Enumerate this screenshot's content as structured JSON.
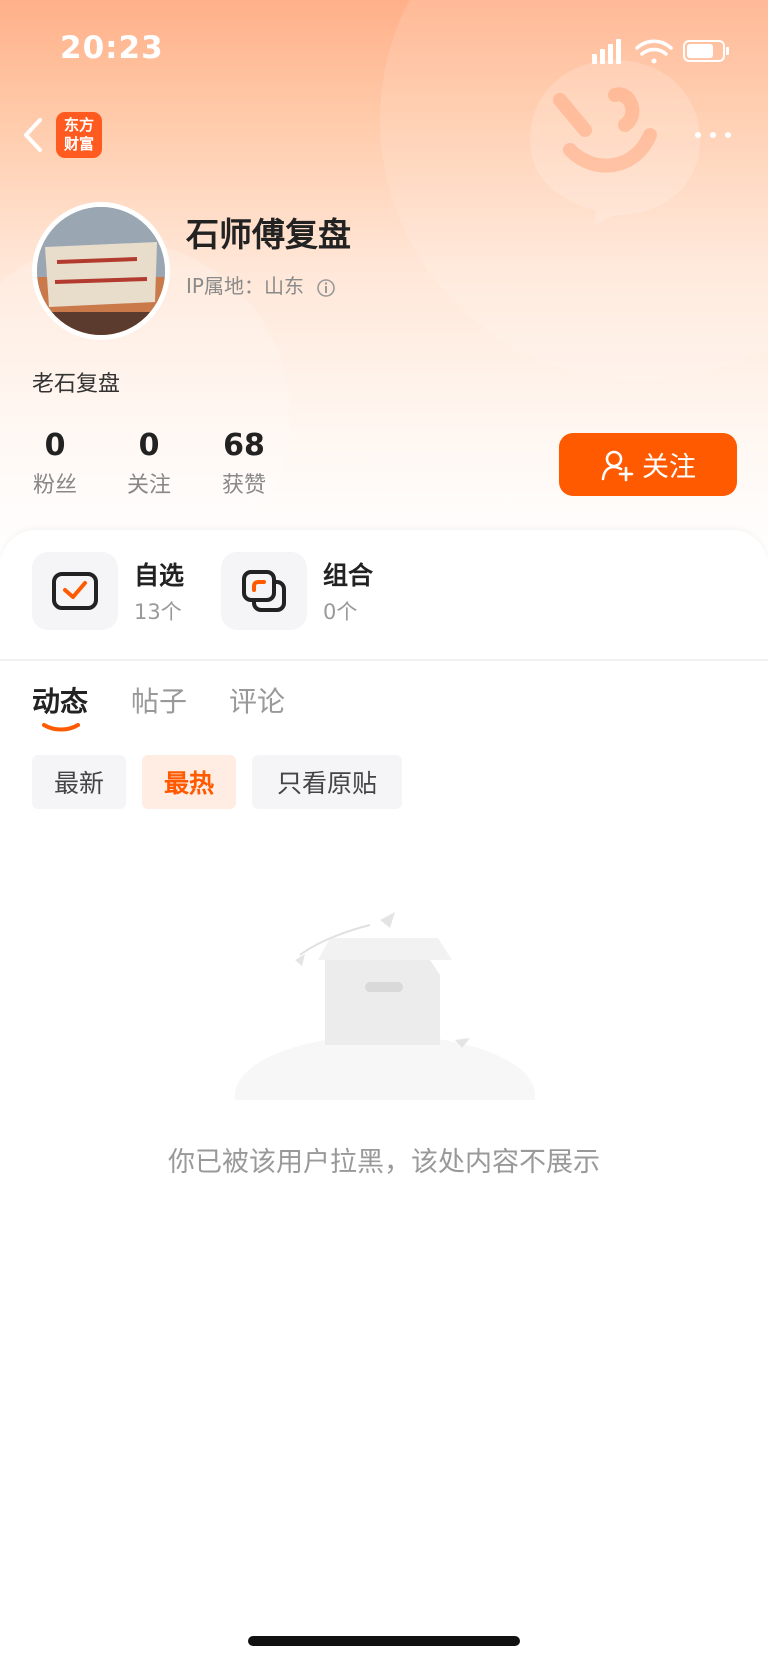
{
  "status_bar": {
    "time": "20:23"
  },
  "nav": {
    "app_logo_line1": "东方",
    "app_logo_line2": "财富"
  },
  "profile": {
    "name": "石师傅复盘",
    "ip_location": "IP属地：山东",
    "bio": "老石复盘",
    "stats": [
      {
        "value": "0",
        "label": "粉丝"
      },
      {
        "value": "0",
        "label": "关注"
      },
      {
        "value": "68",
        "label": "获赞"
      }
    ],
    "follow_label": "关注"
  },
  "shortcuts": [
    {
      "title": "自选",
      "count": "13个"
    },
    {
      "title": "组合",
      "count": "0个"
    }
  ],
  "tabs": [
    "动态",
    "帖子",
    "评论"
  ],
  "filters": [
    "最新",
    "最热",
    "只看原贴"
  ],
  "empty_message": "你已被该用户拉黑，该处内容不展示",
  "colors": {
    "accent": "#ff5a00",
    "header_top": "#ffb089"
  }
}
